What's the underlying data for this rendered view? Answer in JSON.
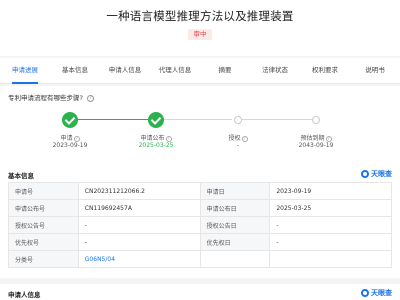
{
  "header": {
    "title": "一种语言模型推理方法以及推理装置",
    "status_badge": "审中"
  },
  "tabs": [
    {
      "label": "申请进展",
      "active": true
    },
    {
      "label": "基本信息"
    },
    {
      "label": "申请人信息"
    },
    {
      "label": "代理人信息"
    },
    {
      "label": "摘要"
    },
    {
      "label": "法律状态"
    },
    {
      "label": "权利要求"
    },
    {
      "label": "说明书"
    }
  ],
  "process": {
    "question": "专利申请流程有哪些步骤?",
    "help_icon": "question-circle-icon",
    "steps": [
      {
        "label": "申请",
        "date": "2023-09-19",
        "state": "done"
      },
      {
        "label": "申请公布",
        "date": "2025-03-25",
        "state": "done"
      },
      {
        "label": "授权",
        "date": "-",
        "state": "todo"
      },
      {
        "label": "预估到期",
        "date": "2043-09-19",
        "state": "todo"
      }
    ]
  },
  "basic_info": {
    "title": "基本信息",
    "brand": "天眼查",
    "rows": [
      {
        "k1": "申请号",
        "v1": "CN202311212066.2",
        "k2": "申请日",
        "v2": "2023-09-19"
      },
      {
        "k1": "申请公布号",
        "v1": "CN119692457A",
        "k2": "申请公布日",
        "v2": "2025-03-25"
      },
      {
        "k1": "授权公告号",
        "v1": "-",
        "k2": "授权公告日",
        "v2": "-"
      },
      {
        "k1": "优先权号",
        "v1": "-",
        "k2": "优先权日",
        "v2": "-"
      },
      {
        "k1": "分类号",
        "v1": "G06N5/04",
        "k2": "",
        "v2": ""
      }
    ]
  },
  "applicant_info": {
    "title": "申请人信息",
    "brand": "天眼查"
  },
  "colors": {
    "accent": "#1a73e8",
    "done": "#2bb24c",
    "badge_bg": "#fde8e8",
    "badge_text": "#e04343"
  }
}
